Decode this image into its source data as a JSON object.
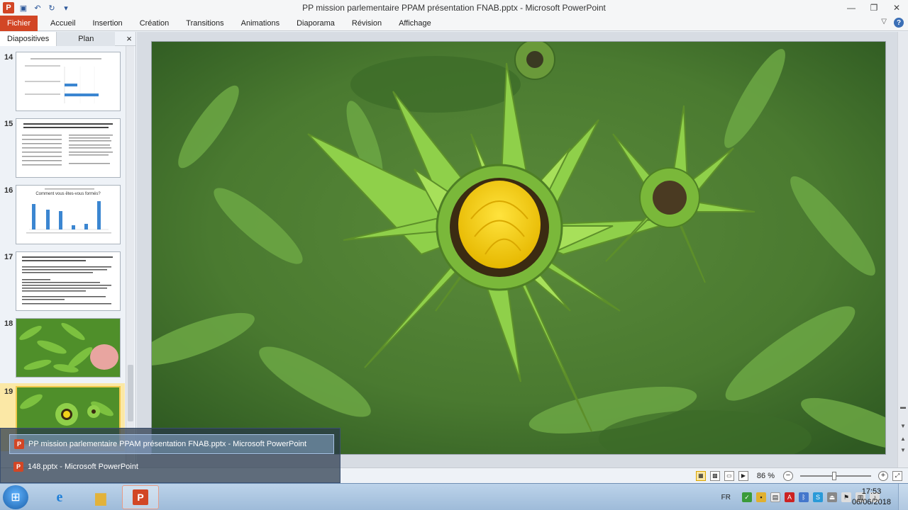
{
  "window": {
    "title": "PP mission parlementaire PPAM présentation FNAB.pptx  -  Microsoft PowerPoint",
    "app_icon_letter": "P",
    "controls": [
      "minimize",
      "restore",
      "close"
    ]
  },
  "ribbon": {
    "tabs": [
      "Fichier",
      "Accueil",
      "Insertion",
      "Création",
      "Transitions",
      "Animations",
      "Diaporama",
      "Révision",
      "Affichage"
    ]
  },
  "panel": {
    "tab_slides": "Diapositives",
    "tab_outline": "Plan",
    "close_symbol": "×",
    "slides": [
      {
        "number": "14",
        "kind": "bar-chart"
      },
      {
        "number": "15",
        "kind": "table"
      },
      {
        "number": "16",
        "kind": "column-chart",
        "title": "Comment vous êtes-vous formés?"
      },
      {
        "number": "17",
        "kind": "text"
      },
      {
        "number": "18",
        "kind": "photo"
      },
      {
        "number": "19",
        "kind": "photo",
        "selected": true
      }
    ]
  },
  "statusbar": {
    "zoom": "86 %",
    "zoom_fraction": 0.48
  },
  "taskbar": {
    "popup_items": [
      "PP mission parlementaire PPAM présentation FNAB.pptx - Microsoft PowerPoint",
      "148.pptx - Microsoft PowerPoint"
    ],
    "language": "FR",
    "time": "17:53",
    "date": "06/06/2018"
  },
  "colors": {
    "accent": "#d24625",
    "selection": "#fbe8a6"
  }
}
